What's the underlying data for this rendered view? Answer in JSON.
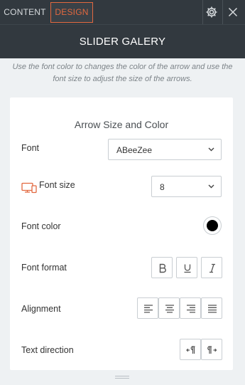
{
  "tabs": [
    {
      "label": "CONTENT",
      "active": false
    },
    {
      "label": "DESIGN",
      "active": true
    }
  ],
  "toolbar_icons": [
    "gear-icon",
    "close-icon"
  ],
  "panel_title": "SLIDER GALERY",
  "hint": "Use the font color to changes the color of the arrow and use the font size to adjust the size of the arrows.",
  "section": {
    "title": "Arrow Size and Color",
    "font": {
      "label": "Font",
      "value": "ABeeZee"
    },
    "font_size": {
      "label": "Font size",
      "value": "8",
      "icon": "monitor-icon"
    },
    "font_color": {
      "label": "Font color",
      "value": "#000000"
    },
    "font_format": {
      "label": "Font format",
      "buttons": [
        "bold-icon",
        "underline-icon",
        "italic-icon"
      ]
    },
    "alignment": {
      "label": "Alignment",
      "buttons": [
        "align-left-icon",
        "align-center-icon",
        "align-right-icon",
        "align-justify-icon"
      ]
    },
    "text_direction": {
      "label": "Text direction",
      "buttons": [
        "rtl-icon",
        "ltr-icon"
      ]
    }
  },
  "colors": {
    "accent": "#e2683f",
    "header": "#32393f",
    "background": "#eef1f3"
  }
}
